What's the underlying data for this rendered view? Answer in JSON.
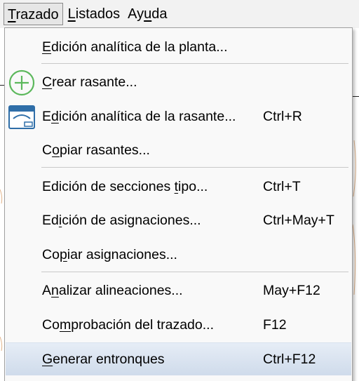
{
  "menubar": {
    "items": [
      {
        "pre": "",
        "ul": "T",
        "post": "razado"
      },
      {
        "pre": "",
        "ul": "L",
        "post": "istados"
      },
      {
        "pre": "Ay",
        "ul": "u",
        "post": "da"
      }
    ]
  },
  "menu": {
    "items": [
      {
        "pre": "",
        "ul": "E",
        "post": "dición analítica de la planta...",
        "shortcut": "",
        "icon": ""
      },
      {
        "pre": "",
        "ul": "C",
        "post": "rear rasante...",
        "shortcut": "",
        "icon": "add-circle-icon"
      },
      {
        "pre": "E",
        "ul": "d",
        "post": "ición analítica de la rasante...",
        "shortcut": "Ctrl+R",
        "icon": "profile-window-icon"
      },
      {
        "pre": "C",
        "ul": "o",
        "post": "piar rasantes...",
        "shortcut": "",
        "icon": ""
      },
      {
        "pre": "Edición de secciones ",
        "ul": "t",
        "post": "ipo...",
        "shortcut": "Ctrl+T",
        "icon": ""
      },
      {
        "pre": "Ed",
        "ul": "i",
        "post": "ción de asignaciones...",
        "shortcut": "Ctrl+May+T",
        "icon": ""
      },
      {
        "pre": "Co",
        "ul": "p",
        "post": "iar asignaciones...",
        "shortcut": "",
        "icon": ""
      },
      {
        "pre": "A",
        "ul": "n",
        "post": "alizar alineaciones...",
        "shortcut": "May+F12",
        "icon": ""
      },
      {
        "pre": "Co",
        "ul": "m",
        "post": "probación del trazado...",
        "shortcut": "F12",
        "icon": ""
      },
      {
        "pre": "",
        "ul": "G",
        "post": "enerar entronques",
        "shortcut": "Ctrl+F12",
        "icon": ""
      }
    ]
  },
  "colors": {
    "icon_green": "#5cb85c",
    "icon_blue": "#2f6ea8",
    "hover_top": "#e6edf6",
    "hover_bottom": "#cfdbeb"
  }
}
